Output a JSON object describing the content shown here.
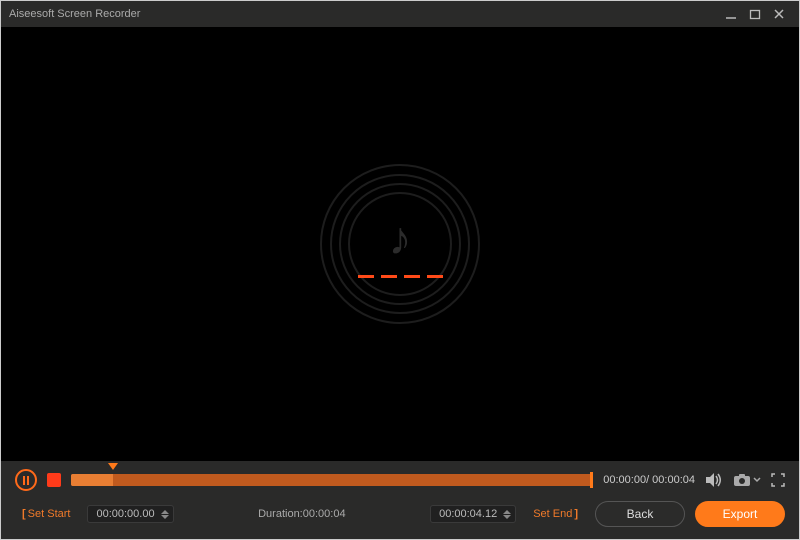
{
  "window": {
    "title": "Aiseesoft Screen Recorder"
  },
  "colors": {
    "accent": "#ff7a1a",
    "accent_dark": "#c05a1e",
    "bg_panel": "#2a2a29",
    "bg_stage": "#000000"
  },
  "icons": {
    "music_note": "♪"
  },
  "playback": {
    "current_time": "00:00:00",
    "total_time": "00:00:04",
    "time_readout": "00:00:00/ 00:00:04",
    "progress_percent": 8
  },
  "clip": {
    "set_start_label": "Set Start",
    "start_time": "00:00:00.00",
    "duration_prefix": "Duration:",
    "duration_time": "00:00:04",
    "duration_label": "Duration:00:00:04",
    "end_time": "00:00:04.12",
    "set_end_label": "Set End"
  },
  "buttons": {
    "back": "Back",
    "export": "Export"
  }
}
